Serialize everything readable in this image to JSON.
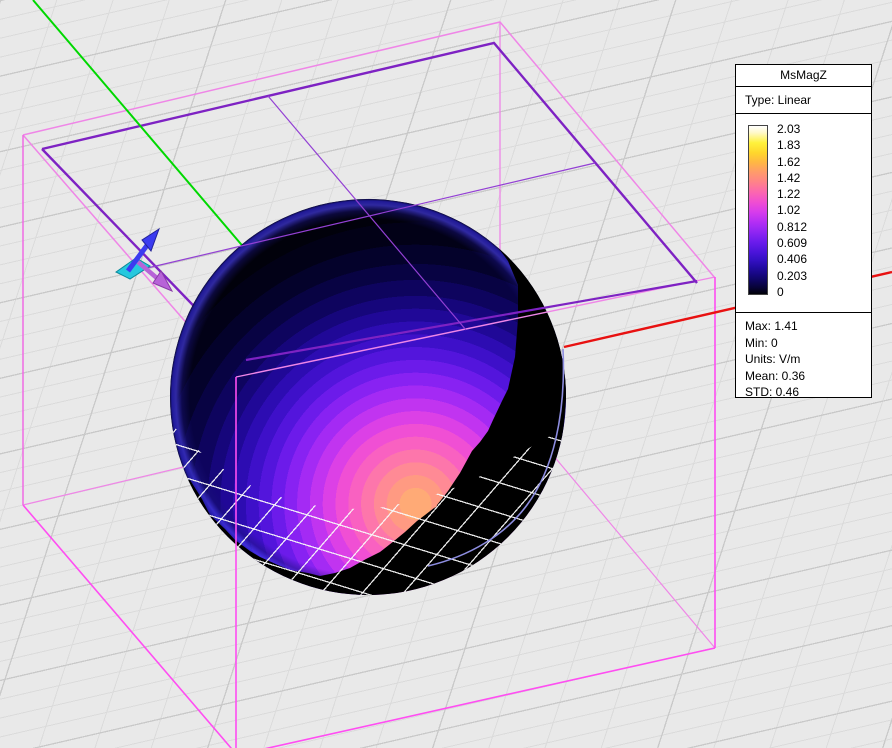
{
  "viewport": {
    "kind": "3d-field-plot-viewport",
    "legend": {
      "field_name": "MsMagZ",
      "type_label": "Type: Linear",
      "scale_labels": [
        "2.03",
        "1.83",
        "1.62",
        "1.42",
        "1.22",
        "1.02",
        "0.812",
        "0.609",
        "0.406",
        "0.203",
        "0"
      ],
      "stats": {
        "max": "Max: 1.41",
        "min": "Min: 0",
        "units": "Units: V/m",
        "mean": "Mean: 0.36",
        "std": "STD: 0.46"
      }
    },
    "colors": {
      "background": "#e9e9e9",
      "grid_minor": "#dbdbdb",
      "grid_major": "#c9c9c9",
      "x_axis": "#e81111",
      "y_axis": "#00d800",
      "bounding_box_outer": "#ef86e7",
      "bounding_box_front": "#ff4df2",
      "substrate_edge": "#7e22c3",
      "sphere_hotspot": "#ffaa76",
      "sphere_low": "#000000",
      "colorbar_top": "#ffffff",
      "colorbar_bottom": "#000000",
      "boundary_grid": "#f8f8f8",
      "sphere_edge_arc": "#8d8de0",
      "port_arrow_blue": "#3b3bf0",
      "port_arrow_cyan": "#25c8de",
      "port_arrow_violet": "#b763d8"
    }
  }
}
